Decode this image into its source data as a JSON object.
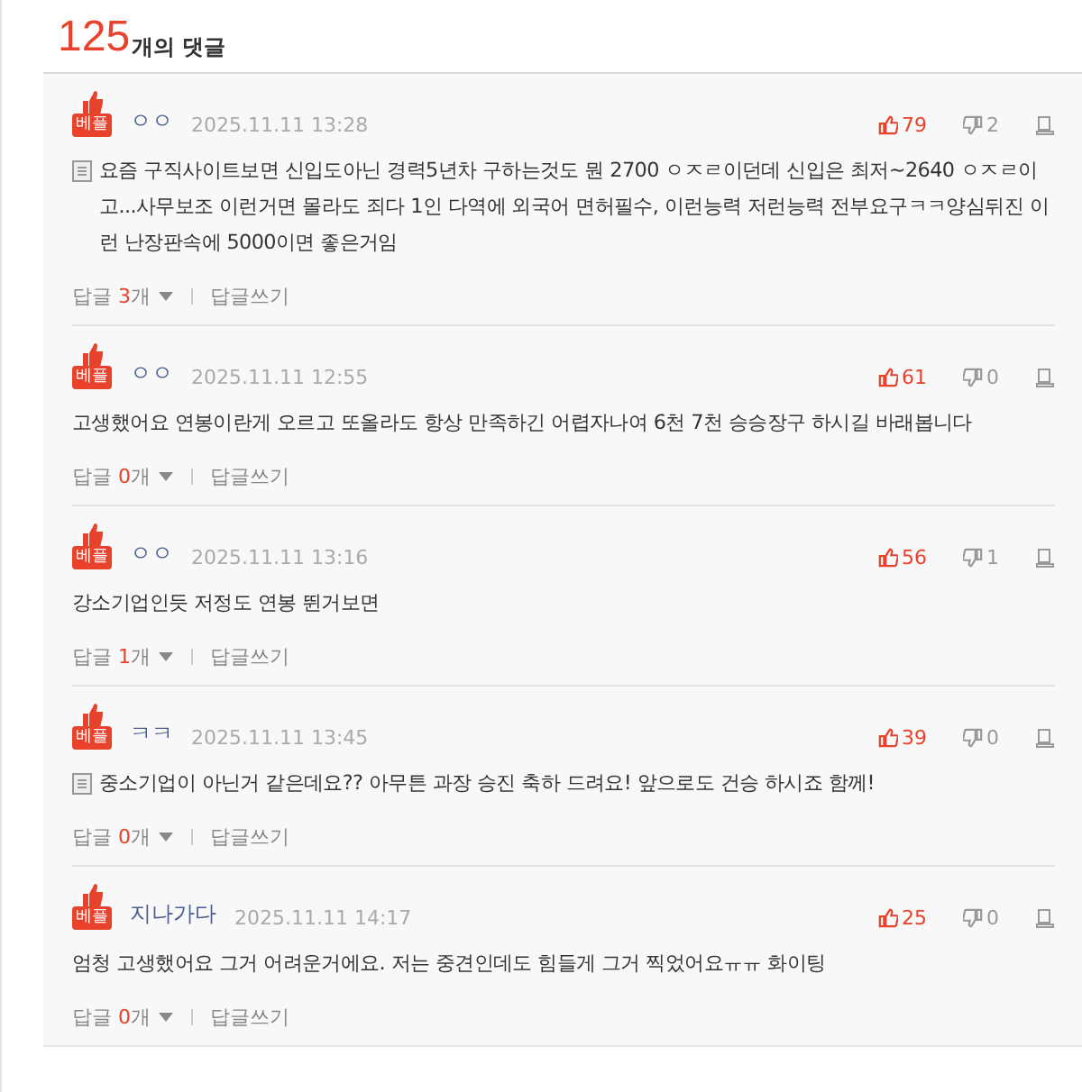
{
  "header": {
    "count": "125",
    "label": "개의 댓글"
  },
  "comments": [
    {
      "badge": "베플",
      "author": "ㅇㅇ",
      "date": "2025.11.11 13:28",
      "likes": "79",
      "dislikes": "2",
      "note_icon": true,
      "text": "요즘 구직사이트보면 신입도아닌 경력5년차 구하는것도 뭔 2700 ㅇㅈㄹ이던데 신입은 최저~2640 ㅇㅈㄹ이고...사무보조 이런거면 몰라도 죄다 1인 다역에 외국어 면허필수, 이런능력 저런능력 전부요구ㅋㅋ양심뒤진 이런 난장판속에 5000이면 좋은거임",
      "reply_label": "답글",
      "reply_count": "3",
      "reply_unit": "개",
      "write_reply": "답글쓰기"
    },
    {
      "badge": "베플",
      "author": "ㅇㅇ",
      "date": "2025.11.11 12:55",
      "likes": "61",
      "dislikes": "0",
      "note_icon": false,
      "text": "고생했어요 연봉이란게 오르고 또올라도 항상 만족하긴 어렵자나여 6천 7천 승승장구 하시길 바래봅니다",
      "reply_label": "답글",
      "reply_count": "0",
      "reply_unit": "개",
      "write_reply": "답글쓰기"
    },
    {
      "badge": "베플",
      "author": "ㅇㅇ",
      "date": "2025.11.11 13:16",
      "likes": "56",
      "dislikes": "1",
      "note_icon": false,
      "text": "강소기업인듯 저정도 연봉 뛴거보면",
      "reply_label": "답글",
      "reply_count": "1",
      "reply_unit": "개",
      "write_reply": "답글쓰기"
    },
    {
      "badge": "베플",
      "author": "ㅋㅋ",
      "date": "2025.11.11 13:45",
      "likes": "39",
      "dislikes": "0",
      "note_icon": true,
      "text": "중소기업이 아닌거 같은데요?? 아무튼 과장 승진 축하 드려요! 앞으로도 건승 하시죠 함께!",
      "reply_label": "답글",
      "reply_count": "0",
      "reply_unit": "개",
      "write_reply": "답글쓰기"
    },
    {
      "badge": "베플",
      "author": "지나가다",
      "date": "2025.11.11 14:17",
      "likes": "25",
      "dislikes": "0",
      "note_icon": false,
      "text": "엄청 고생했어요 그거 어려운거에요. 저는 중견인데도 힘들게 그거 찍었어요ㅠㅠ 화이팅",
      "reply_label": "답글",
      "reply_count": "0",
      "reply_unit": "개",
      "write_reply": "답글쓰기"
    }
  ]
}
